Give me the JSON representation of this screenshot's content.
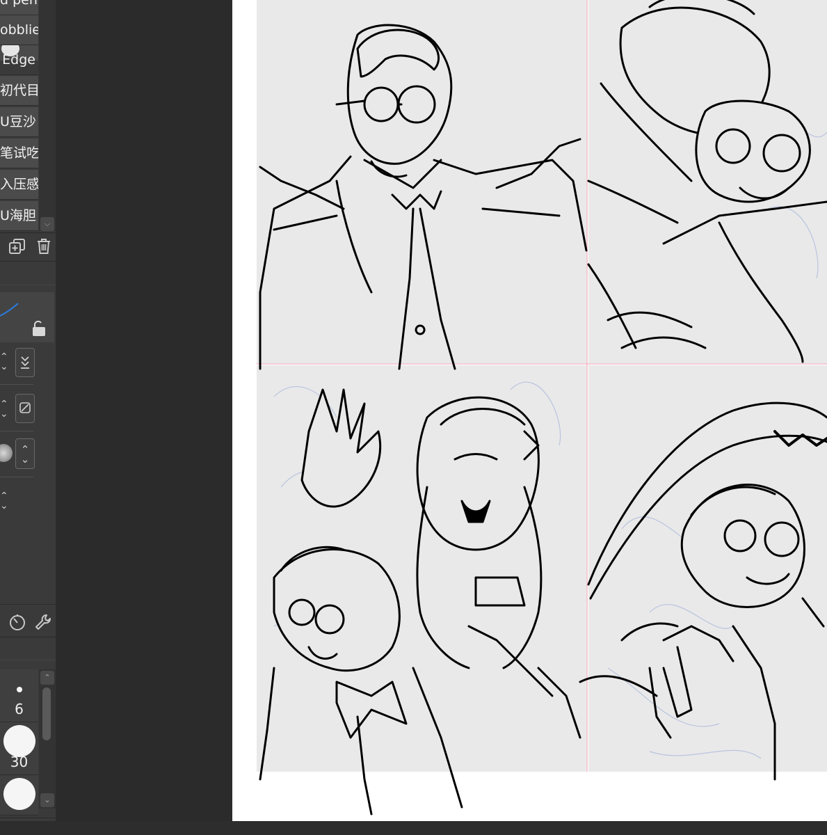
{
  "brush_list": {
    "items": [
      {
        "label": "d pen"
      },
      {
        "label": "obblie"
      },
      {
        "label": ""
      },
      {
        "label": "Edge"
      },
      {
        "label": "初代目"
      },
      {
        "label": "U豆沙"
      },
      {
        "label": "笔试吃"
      },
      {
        "label": "入压感"
      },
      {
        "label": "U海胆"
      }
    ]
  },
  "brush_sizes": {
    "items": [
      {
        "label": "6"
      },
      {
        "label": "30"
      },
      {
        "label": ""
      }
    ]
  },
  "icons": {
    "duplicate": "duplicate-icon",
    "trash": "trash-icon",
    "lock": "lock-icon",
    "stabilizer": "stabilizer-icon",
    "settings": "wrench-icon"
  },
  "colors": {
    "panel_bg": "#3a3a3a",
    "canvas_bg": "#2b2b2b",
    "page_bg": "#ffffff",
    "panel_fill": "#e8e8e8",
    "ink": "#000000",
    "guide": "#f2b8c6",
    "sketch": "#b9c4dd",
    "stroke_preview": "#2a7de1"
  }
}
